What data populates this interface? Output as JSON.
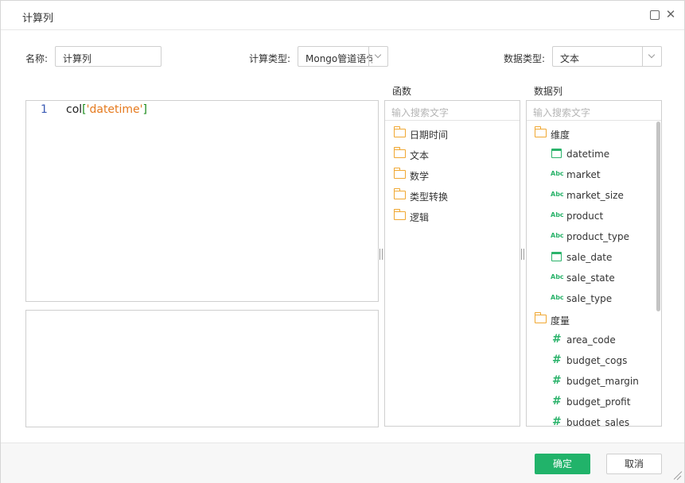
{
  "dialog": {
    "title": "计算列"
  },
  "form": {
    "name_label": "名称:",
    "name_value": "计算列",
    "calc_type_label": "计算类型:",
    "calc_type_value": "Mongo管道语句",
    "data_type_label": "数据类型:",
    "data_type_value": "文本"
  },
  "editor": {
    "line_number": "1",
    "code_prefix": "col",
    "code_open": "[",
    "code_string": "'datetime'",
    "code_close": "]"
  },
  "functions": {
    "header": "函数",
    "search_placeholder": "输入搜索文字",
    "folders": [
      {
        "label": "日期时间",
        "icon": "folder-icon"
      },
      {
        "label": "文本",
        "icon": "folder-icon"
      },
      {
        "label": "数学",
        "icon": "folder-icon"
      },
      {
        "label": "类型转换",
        "icon": "folder-icon"
      },
      {
        "label": "逻辑",
        "icon": "folder-icon"
      }
    ]
  },
  "columns": {
    "header": "数据列",
    "search_placeholder": "输入搜索文字",
    "dimension_folder": "维度",
    "dimension_items": [
      {
        "label": "datetime",
        "icon": "date-icon"
      },
      {
        "label": "market",
        "icon": "text-abc-icon"
      },
      {
        "label": "market_size",
        "icon": "text-abc-icon"
      },
      {
        "label": "product",
        "icon": "text-abc-icon"
      },
      {
        "label": "product_type",
        "icon": "text-abc-icon"
      },
      {
        "label": "sale_date",
        "icon": "date-icon"
      },
      {
        "label": "sale_state",
        "icon": "text-abc-icon"
      },
      {
        "label": "sale_type",
        "icon": "text-abc-icon"
      }
    ],
    "measure_folder": "度量",
    "measure_items": [
      {
        "label": "area_code",
        "icon": "number-hash-icon"
      },
      {
        "label": "budget_cogs",
        "icon": "number-hash-icon"
      },
      {
        "label": "budget_margin",
        "icon": "number-hash-icon"
      },
      {
        "label": "budget_profit",
        "icon": "number-hash-icon"
      },
      {
        "label": "budget_sales",
        "icon": "number-hash-icon"
      }
    ],
    "abc_glyph": "Abc",
    "hash_glyph": "#"
  },
  "footer": {
    "ok_label": "确定",
    "cancel_label": "取消"
  },
  "colors": {
    "accent": "#21b36a",
    "folder": "#f0a833",
    "code_string": "#e57a1e",
    "code_bracket": "#1a8a1a",
    "line_number": "#3b5bb5"
  }
}
